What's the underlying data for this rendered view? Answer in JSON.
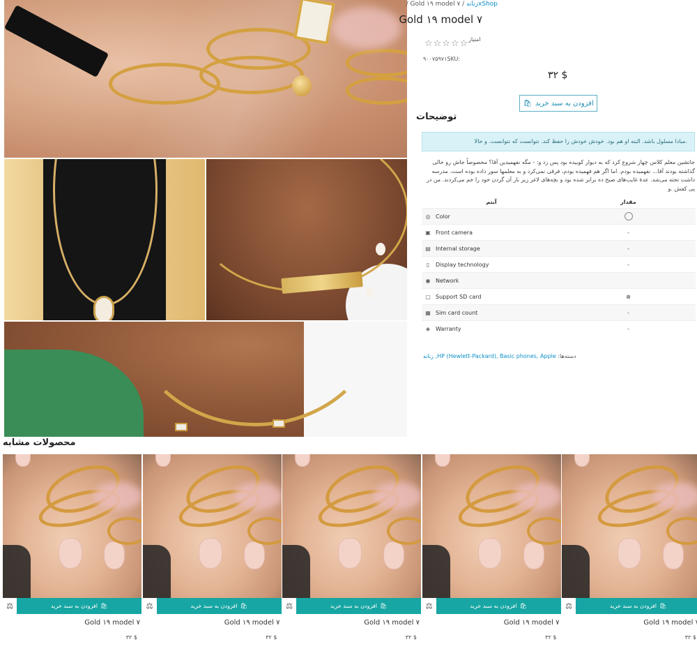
{
  "breadcrumb": {
    "home": "xShop",
    "category": "زنانه",
    "current": "Gold ۱۹ model ۷"
  },
  "product": {
    "title": "Gold ۱۹ model ۷",
    "rating_label": "امتیاز",
    "stars": "☆☆☆☆☆",
    "sku": "۹۰۰۷۵۹۷۱SKU:",
    "price": "۳۲ $",
    "add_to_cart": "افزودن به سبد خرید"
  },
  "description": {
    "title": "توضیحات",
    "alert": ".مبادا مسلول باشد. البته او هم بود. خودش خودش را حفظ کند. نتوانست که نتوانست. و حالا",
    "text": "جانشین معلم کلاس چهار شروع کرد که به دیوار کوبیده بود پس زد و: - مگه نفهمیدین آقا؟ مخصوصاً جاش رو خالی گذاشته بودند آقا... نفهمیده بودم. اما اگر هم فهمیده بودم، فرقی نمی‌کرد و به معلمها سور داده بوده است. مدرسه داشت تخته می‌شد. عدهٔ غایب‌های صبح ده برابر شده بود و بچه‌های لاغر زیر بار آن گردن خود را خم می‌کردند. من در پی کفش .و"
  },
  "spec_table": {
    "headers": {
      "item": "آیتم",
      "value": "مقدار"
    },
    "rows": [
      {
        "icon": "palette-icon",
        "glyph": "◎",
        "name": "Color",
        "value": "",
        "value_type": "circle"
      },
      {
        "icon": "camera-icon",
        "glyph": "▣",
        "name": "Front camera",
        "value": "-"
      },
      {
        "icon": "storage-icon",
        "glyph": "▤",
        "name": "Internal storage",
        "value": "-"
      },
      {
        "icon": "display-icon",
        "glyph": "▯",
        "name": "Display technology",
        "value": "-"
      },
      {
        "icon": "network-icon",
        "glyph": "◉",
        "name": "Network",
        "value": ""
      },
      {
        "icon": "sd-card-icon",
        "glyph": "▢",
        "name": "Support SD card",
        "value": "⊗"
      },
      {
        "icon": "sim-card-icon",
        "glyph": "▦",
        "name": "Sim card count",
        "value": "-"
      },
      {
        "icon": "warranty-icon",
        "glyph": "◈",
        "name": "Warranty",
        "value": "-"
      }
    ]
  },
  "categories": {
    "label": "دسته‌ها:",
    "links": "HP (Hewlett-Packard), Basic phones, Apple, زنانه"
  },
  "related": {
    "title": "محصولات مشابه",
    "items": [
      {
        "name": "Gold ۱۹ model ۷",
        "price": "۳۲ $",
        "add_label": "افزودن به سبد خرید"
      },
      {
        "name": "Gold ۱۹ model ۷",
        "price": "۳۲ $",
        "add_label": "افزودن به سبد خرید"
      },
      {
        "name": "Gold ۱۹ model ۷",
        "price": "۳۲ $",
        "add_label": "افزودن به سبد خرید"
      },
      {
        "name": "Gold ۱۹ model ۷",
        "price": "۳۲ $",
        "add_label": "افزودن به سبد خرید"
      },
      {
        "name": "Gold ۱۹ model ۷",
        "price": "۳۲ $",
        "add_label": "افزودن به سبد خرید"
      }
    ]
  }
}
